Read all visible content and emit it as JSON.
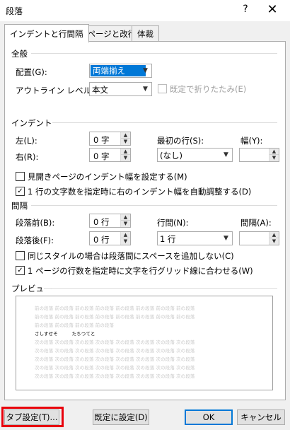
{
  "window": {
    "title": "段落",
    "help": "?",
    "close": "✕"
  },
  "tabs": [
    {
      "label": "インデントと行間隔",
      "active": true
    },
    {
      "label": "改ページと改行",
      "active": false
    },
    {
      "label": "体裁",
      "active": false
    }
  ],
  "general": {
    "title": "全般",
    "alignment_label": "配置(G):",
    "alignment_value": "両端揃え",
    "outline_label": "アウトライン レベル(O):",
    "outline_value": "本文",
    "collapse_label": "既定で折りたたみ(E)"
  },
  "indent": {
    "title": "インデント",
    "left_label": "左(L):",
    "left_value": "0 字",
    "right_label": "右(R):",
    "right_value": "0 字",
    "first_line_label": "最初の行(S):",
    "first_line_value": "(なし)",
    "width_label": "幅(Y):",
    "width_value": "",
    "mirror_label": "見開きページのインデント幅を設定する(M)",
    "mirror_checked": false,
    "auto_adjust_label": "1 行の文字数を指定時に右のインデント幅を自動調整する(D)",
    "auto_adjust_checked": true
  },
  "spacing": {
    "title": "間隔",
    "before_label": "段落前(B):",
    "before_value": "0 行",
    "after_label": "段落後(F):",
    "after_value": "0 行",
    "line_spacing_label": "行間(N):",
    "line_spacing_value": "1 行",
    "at_label": "間隔(A):",
    "at_value": "",
    "no_space_label": "同じスタイルの場合は段落間にスペースを追加しない(C)",
    "no_space_checked": false,
    "grid_label": "1 ページの行数を指定時に文字を行グリッド線に合わせる(W)",
    "grid_checked": true
  },
  "preview": {
    "title": "プレビュー",
    "prev_lines": [
      "前の段落 前の段落 前の段落 前の段落 前の段落 前の段落 前の段落 前の段落",
      "前の段落 前の段落 前の段落 前の段落 前の段落 前の段落 前の段落 前の段落",
      "前の段落 前の段落 前の段落 前の段落"
    ],
    "current_line": "さしすせそ　　　たちつてと",
    "next_lines": [
      "次の段落 次の段落 次の段落 次の段落 次の段落 次の段落 次の段落 次の段落",
      "次の段落 次の段落 次の段落 次の段落 次の段落 次の段落 次の段落 次の段落",
      "次の段落 次の段落 次の段落 次の段落 次の段落 次の段落 次の段落 次の段落",
      "次の段落 次の段落 次の段落 次の段落 次の段落 次の段落 次の段落 次の段落",
      "次の段落 次の段落 次の段落 次の段落 次の段落 次の段落 次の段落 次の段落"
    ]
  },
  "buttons": {
    "tabs": "タブ設定(T)...",
    "set_default": "既定に設定(D)",
    "ok": "OK",
    "cancel": "キャンセル"
  },
  "colors": {
    "highlight": "#e8000b",
    "selection": "#0078d7"
  }
}
